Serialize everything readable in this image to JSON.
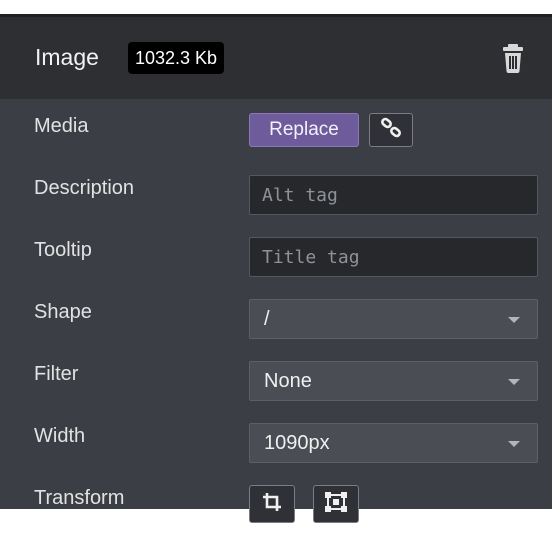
{
  "header": {
    "title": "Image",
    "file_size": "1032.3 Kb",
    "delete_icon": "trash-icon"
  },
  "rows": {
    "media": {
      "label": "Media",
      "replace_label": "Replace",
      "link_icon": "link-icon"
    },
    "description": {
      "label": "Description",
      "value": "",
      "placeholder": "Alt tag"
    },
    "tooltip": {
      "label": "Tooltip",
      "value": "",
      "placeholder": "Title tag"
    },
    "shape": {
      "label": "Shape",
      "selected": "/"
    },
    "filter": {
      "label": "Filter",
      "selected": "None"
    },
    "width": {
      "label": "Width",
      "selected": "1090px"
    },
    "transform": {
      "label": "Transform",
      "icons": [
        "crop-icon",
        "resize-icon"
      ]
    }
  },
  "colors": {
    "panel_bg": "#3b3e45",
    "header_bg": "#2d2f33",
    "accent": "#6e5b9c"
  }
}
